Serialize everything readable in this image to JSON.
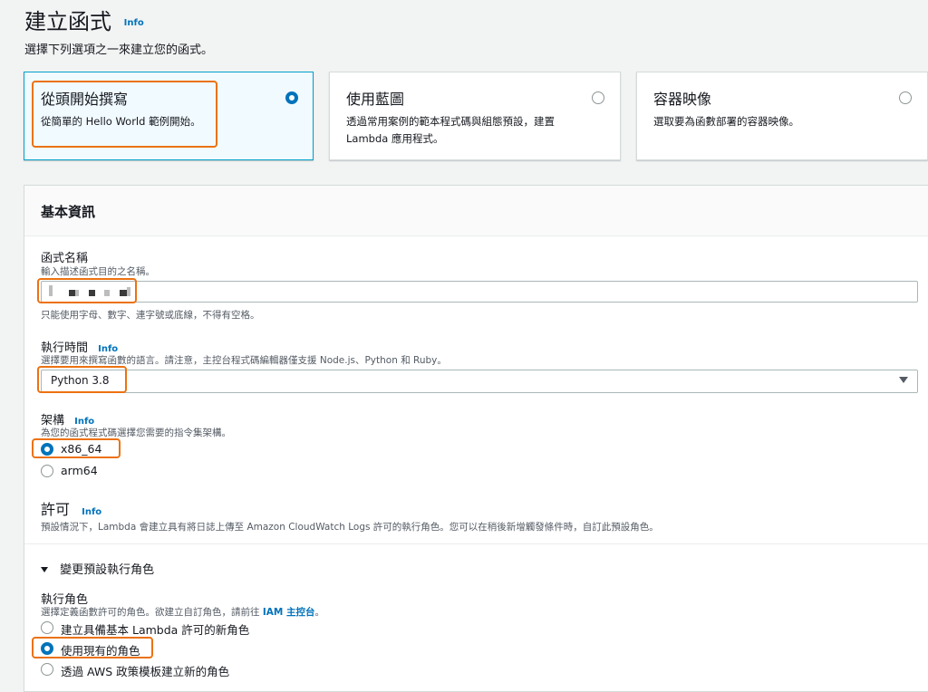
{
  "page": {
    "title": "建立函式",
    "info": "Info",
    "subtitle": "選擇下列選項之一來建立您的函式。"
  },
  "options": [
    {
      "title": "從頭開始撰寫",
      "desc": "從簡單的 Hello World 範例開始。",
      "selected": true
    },
    {
      "title": "使用藍圖",
      "desc": "透過常用案例的範本程式碼與組態預設，建置 Lambda 應用程式。",
      "selected": false
    },
    {
      "title": "容器映像",
      "desc": "選取要為函數部署的容器映像。",
      "selected": false
    }
  ],
  "basic": {
    "title": "基本資訊",
    "function_name": {
      "label": "函式名稱",
      "hint": "輸入描述函式目的之名稱。",
      "rule": "只能使用字母、數字、連字號或底線，不得有空格。"
    },
    "runtime": {
      "label": "執行時間",
      "info": "Info",
      "hint": "選擇要用來撰寫函數的語言。請注意，主控台程式碼編輯器僅支援 Node.js、Python 和 Ruby。",
      "value": "Python 3.8"
    },
    "arch": {
      "label": "架構",
      "info": "Info",
      "hint": "為您的函式程式碼選擇您需要的指令集架構。",
      "options": [
        "x86_64",
        "arm64"
      ],
      "selected": "x86_64"
    },
    "permissions": {
      "title": "許可",
      "info": "Info",
      "desc": "預設情況下，Lambda 會建立具有將日誌上傳至 Amazon CloudWatch Logs 許可的執行角色。您可以在稍後新增觸發條件時，自訂此預設角色。"
    },
    "change_role": {
      "toggle": "變更預設執行角色"
    },
    "exec_role": {
      "label": "執行角色",
      "hint_prefix": "選擇定義函數許可的角色。欲建立自訂角色，請前往 ",
      "hint_link": "IAM 主控台",
      "hint_suffix": "。",
      "options": [
        "建立具備基本 Lambda 許可的新角色",
        "使用現有的角色",
        "透過 AWS 政策模板建立新的角色"
      ],
      "selected": "使用現有的角色"
    }
  },
  "colors": {
    "accent": "#0073bb",
    "highlight": "#ec7211"
  }
}
